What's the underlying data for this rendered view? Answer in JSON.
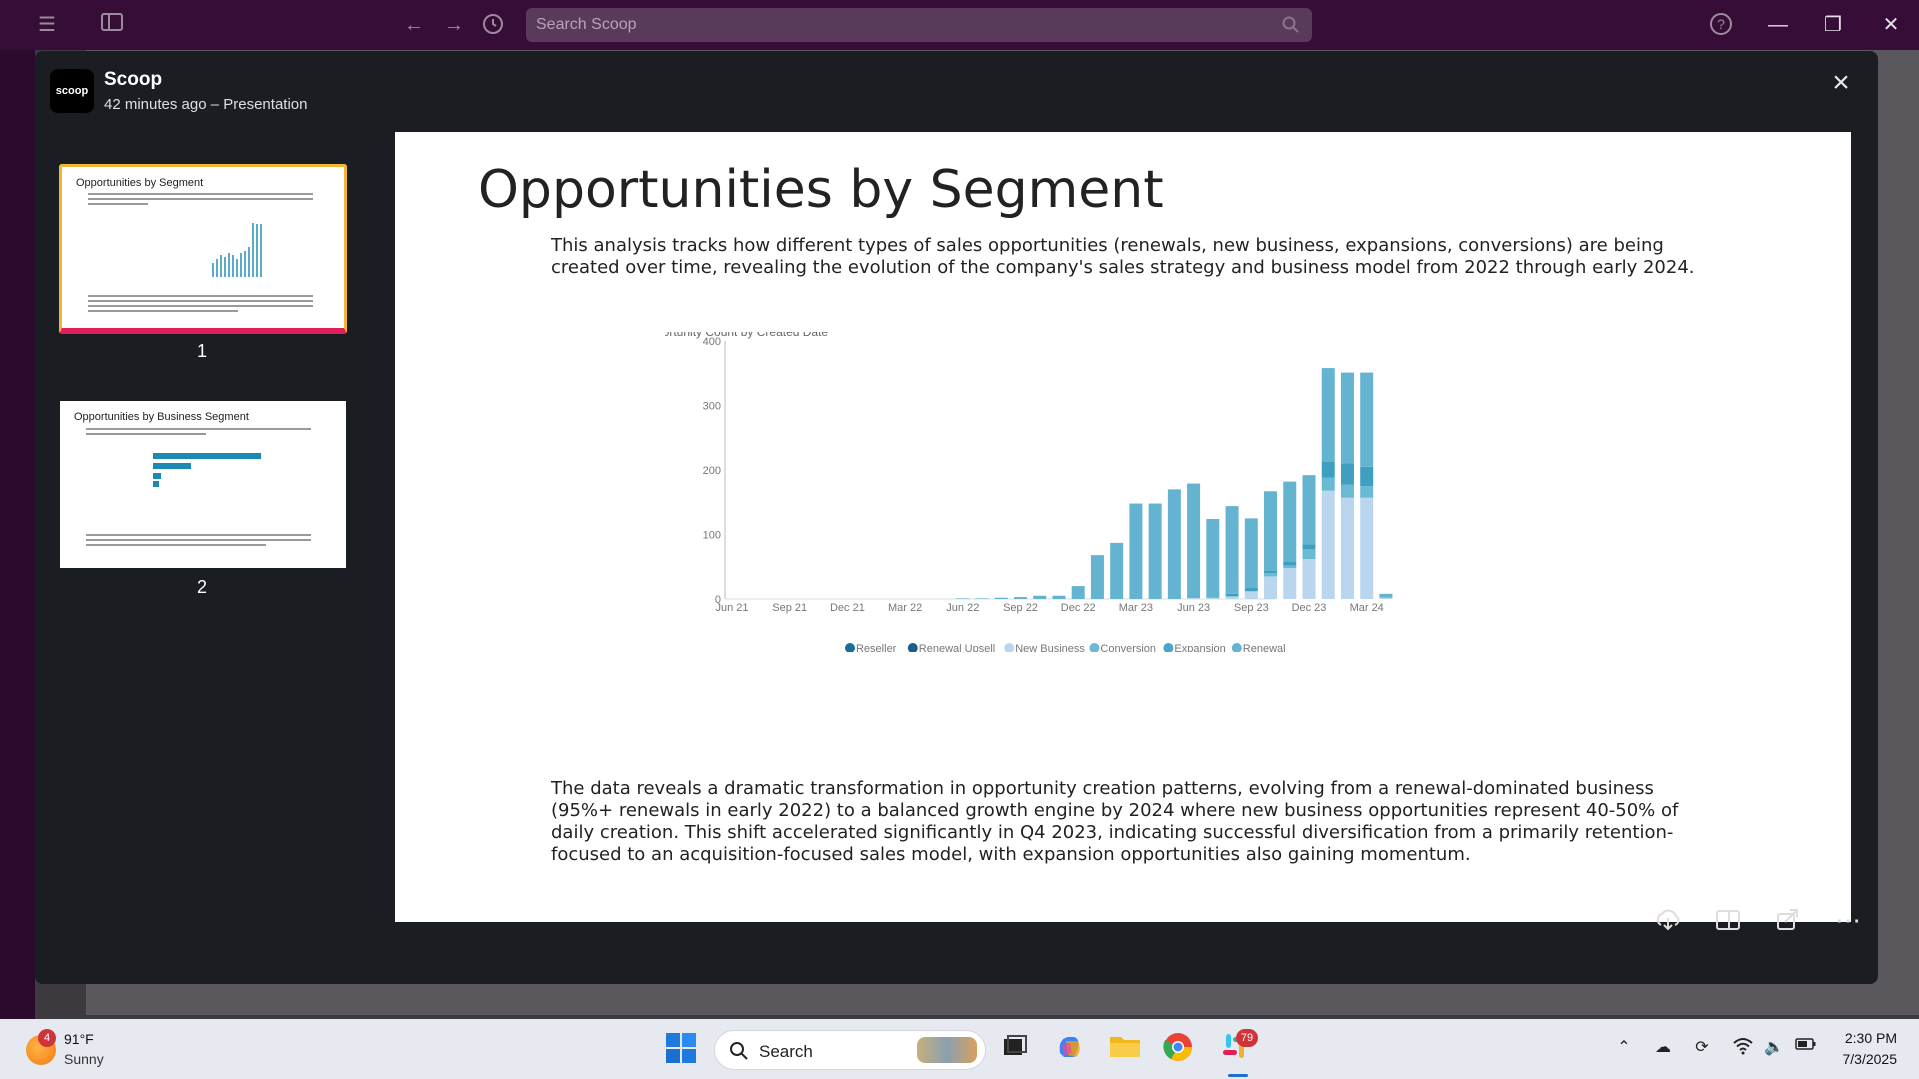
{
  "topbar": {
    "search_placeholder": "Search Scoop"
  },
  "modal": {
    "app_logo_text": "scoop",
    "title": "Scoop",
    "subtitle": "42 minutes ago – Presentation",
    "thumbnails": [
      {
        "number": "1",
        "title": "Opportunities by Segment"
      },
      {
        "number": "2",
        "title": "Opportunities by Business Segment"
      }
    ]
  },
  "slide": {
    "title": "Opportunities by Segment",
    "intro": "This analysis tracks how different types of sales opportunities (renewals, new business, expansions, conversions) are being created over time, revealing the evolution of the company's sales strategy and business model from 2022 through early 2024.",
    "conclusion": "The data reveals a dramatic transformation in opportunity creation patterns, evolving from a renewal-dominated business (95%+ renewals in early 2022) to a balanced growth engine by 2024 where new business opportunities represent 40-50% of daily creation. This shift accelerated significantly in Q4 2023, indicating successful diversification from a primarily retention-focused to an acquisition-focused sales model, with expansion opportunities also gaining momentum."
  },
  "chart_data": {
    "type": "bar",
    "stacked": true,
    "title": "Opportunity Count by Created Date",
    "ylim": [
      0,
      400
    ],
    "yticks": [
      0,
      100,
      200,
      300,
      400
    ],
    "xticks": [
      "Jun 21",
      "Sep 21",
      "Dec 21",
      "Mar 22",
      "Jun 22",
      "Sep 22",
      "Dec 22",
      "Mar 23",
      "Jun 23",
      "Sep 23",
      "Dec 23",
      "Mar 24"
    ],
    "legend_position": "bottom",
    "legend": [
      {
        "name": "Reseller",
        "color": "#1a6f9a"
      },
      {
        "name": "Renewal Upsell",
        "color": "#1b5f86"
      },
      {
        "name": "New Business",
        "color": "#b9d6ee"
      },
      {
        "name": "Conversion",
        "color": "#6bbad4"
      },
      {
        "name": "Expansion",
        "color": "#4aa6c4"
      },
      {
        "name": "Renewal",
        "color": "#64b3d1"
      }
    ],
    "bars": [
      {
        "month": "Jun 22",
        "new_business": 0,
        "conversion": 0,
        "expansion": 0,
        "renewal": 1
      },
      {
        "month": "Jul 22",
        "new_business": 0,
        "conversion": 0,
        "expansion": 0,
        "renewal": 1
      },
      {
        "month": "Aug 22",
        "new_business": 0,
        "conversion": 0,
        "expansion": 0,
        "renewal": 2
      },
      {
        "month": "Sep 22",
        "new_business": 0,
        "conversion": 0,
        "expansion": 0,
        "renewal": 3
      },
      {
        "month": "Oct 22",
        "new_business": 0,
        "conversion": 0,
        "expansion": 0,
        "renewal": 5
      },
      {
        "month": "Nov 22",
        "new_business": 0,
        "conversion": 0,
        "expansion": 0,
        "renewal": 5
      },
      {
        "month": "Dec 22",
        "new_business": 0,
        "conversion": 0,
        "expansion": 0,
        "renewal": 20
      },
      {
        "month": "Jan 23",
        "new_business": 0,
        "conversion": 0,
        "expansion": 0,
        "renewal": 68
      },
      {
        "month": "Feb 23",
        "new_business": 0,
        "conversion": 0,
        "expansion": 0,
        "renewal": 87
      },
      {
        "month": "Mar 23",
        "new_business": 0,
        "conversion": 0,
        "expansion": 0,
        "renewal": 148
      },
      {
        "month": "Apr 23",
        "new_business": 0,
        "conversion": 0,
        "expansion": 0,
        "renewal": 148
      },
      {
        "month": "May 23",
        "new_business": 0,
        "conversion": 0,
        "expansion": 0,
        "renewal": 170
      },
      {
        "month": "Jun 23",
        "new_business": 2,
        "conversion": 0,
        "expansion": 2,
        "renewal": 175
      },
      {
        "month": "Jul 23",
        "new_business": 2,
        "conversion": 0,
        "expansion": 1,
        "renewal": 121
      },
      {
        "month": "Aug 23",
        "new_business": 4,
        "conversion": 0,
        "expansion": 4,
        "renewal": 136
      },
      {
        "month": "Sep 23",
        "new_business": 12,
        "conversion": 0,
        "expansion": 5,
        "renewal": 108
      },
      {
        "month": "Oct 23",
        "new_business": 35,
        "conversion": 5,
        "expansion": 4,
        "renewal": 123
      },
      {
        "month": "Nov 23",
        "new_business": 48,
        "conversion": 4,
        "expansion": 6,
        "renewal": 124
      },
      {
        "month": "Dec 23",
        "new_business": 62,
        "conversion": 15,
        "expansion": 8,
        "renewal": 107
      },
      {
        "month": "Jan 24",
        "new_business": 168,
        "conversion": 20,
        "expansion": 25,
        "renewal": 145
      },
      {
        "month": "Feb 24",
        "new_business": 157,
        "conversion": 20,
        "expansion": 33,
        "renewal": 141
      },
      {
        "month": "Mar 24",
        "new_business": 157,
        "conversion": 18,
        "expansion": 30,
        "renewal": 146
      },
      {
        "month": "Apr 24",
        "new_business": 2,
        "conversion": 0,
        "expansion": 0,
        "renewal": 6
      }
    ]
  },
  "taskbar": {
    "weather_badge": "4",
    "weather_temp": "91°F",
    "weather_cond": "Sunny",
    "search_label": "Search",
    "slack_badge": "79",
    "time": "2:30 PM",
    "date": "7/3/2025"
  },
  "colors": {
    "slack_purple": "#350d36",
    "modal_bg": "#1a1d21",
    "thumb_border": "#f4b43a",
    "thumb_accent": "#e01e5a"
  }
}
